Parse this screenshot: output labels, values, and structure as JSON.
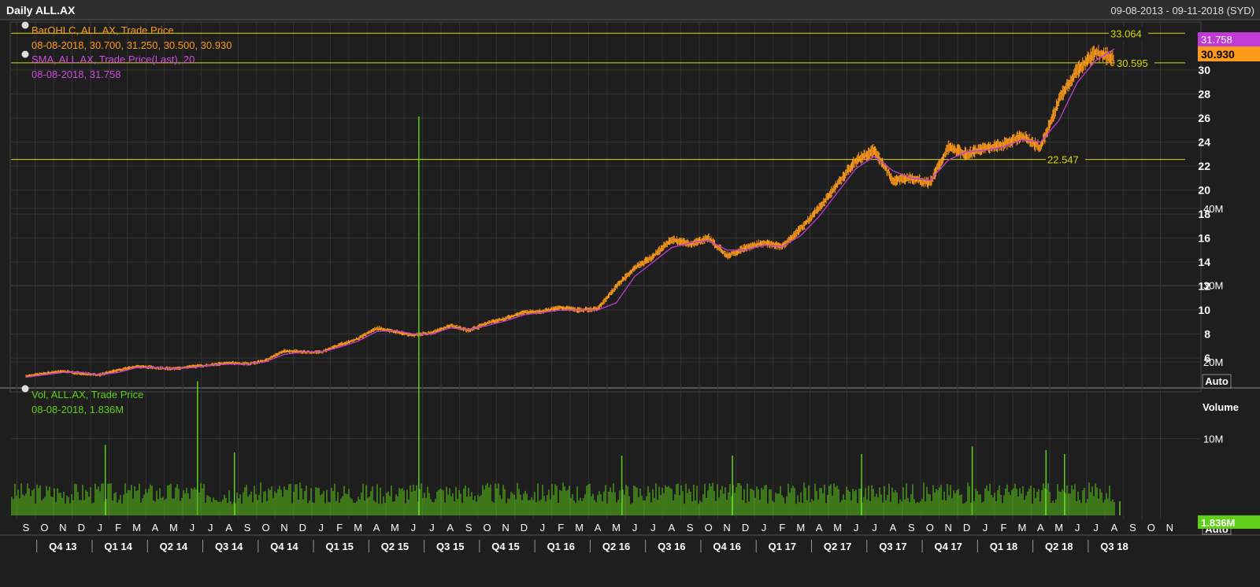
{
  "header": {
    "title": "Daily ALL.AX",
    "date_range": "09-08-2013 - 09-11-2018 (SYD)"
  },
  "colors": {
    "background": "#1e1e1e",
    "grid": "#333333",
    "price_bars": "#ff9a1a",
    "sma": "#c13bd6",
    "volume": "#5fcf1a",
    "hlines": "#d7d700",
    "axis_text": "#ffffff"
  },
  "legend": {
    "price_series": "BarOHLC, ALL.AX, Trade Price",
    "price_values": "08-08-2018, 30.700, 31.250, 30.500, 30.930",
    "sma_series": "SMA, ALL.AX, Trade Price(Last), 20",
    "sma_values": "08-08-2018, 31.758",
    "volume_series": "Vol, ALL.AX, Trade Price",
    "volume_values": "08-08-2018, 1.836M"
  },
  "price_axis": {
    "ticks": [
      "6",
      "8",
      "10",
      "12",
      "14",
      "16",
      "18",
      "20",
      "22",
      "24",
      "26",
      "28",
      "30"
    ],
    "scale_button": "Auto",
    "sma_tag": "31.758",
    "last_tag": "30.930"
  },
  "volume_axis": {
    "title": "Volume",
    "ticks": [
      "10M",
      "20M",
      "30M",
      "40M"
    ],
    "last_tag": "1.836M",
    "scale_button": "Auto"
  },
  "hlines": [
    "33.064",
    "30.595",
    "22.547"
  ],
  "time_axis": {
    "months": [
      "S",
      "O",
      "N",
      "D",
      "J",
      "F",
      "M",
      "A",
      "M",
      "J",
      "J",
      "A",
      "S",
      "O",
      "N",
      "D",
      "J",
      "F",
      "M",
      "A",
      "M",
      "J",
      "J",
      "A",
      "S",
      "O",
      "N",
      "D",
      "J",
      "F",
      "M",
      "A",
      "M",
      "J",
      "J",
      "A",
      "S",
      "O",
      "N",
      "D",
      "J",
      "F",
      "M",
      "A",
      "M",
      "J",
      "J",
      "A",
      "S",
      "O",
      "N",
      "D",
      "J",
      "F",
      "M",
      "A",
      "M",
      "J",
      "J",
      "A",
      "S",
      "O",
      "N"
    ],
    "quarters": [
      "Q4 13",
      "Q1 14",
      "Q2 14",
      "Q3 14",
      "Q4 14",
      "Q1 15",
      "Q2 15",
      "Q3 15",
      "Q4 15",
      "Q1 16",
      "Q2 16",
      "Q3 16",
      "Q4 16",
      "Q1 17",
      "Q2 17",
      "Q3 17",
      "Q4 17",
      "Q1 18",
      "Q2 18",
      "Q3 18"
    ]
  },
  "chart_data": [
    {
      "type": "line",
      "series": [
        {
          "name": "BarOHLC, ALL.AX, Trade Price",
          "x": [
            "2013-09",
            "2013-10",
            "2013-11",
            "2013-12",
            "2014-01",
            "2014-02",
            "2014-03",
            "2014-04",
            "2014-05",
            "2014-06",
            "2014-07",
            "2014-08",
            "2014-09",
            "2014-10",
            "2014-11",
            "2014-12",
            "2015-01",
            "2015-02",
            "2015-03",
            "2015-04",
            "2015-05",
            "2015-06",
            "2015-07",
            "2015-08",
            "2015-09",
            "2015-10",
            "2015-11",
            "2015-12",
            "2016-01",
            "2016-02",
            "2016-03",
            "2016-04",
            "2016-05",
            "2016-06",
            "2016-07",
            "2016-08",
            "2016-09",
            "2016-10",
            "2016-11",
            "2016-12",
            "2017-01",
            "2017-02",
            "2017-03",
            "2017-04",
            "2017-05",
            "2017-06",
            "2017-07",
            "2017-08",
            "2017-09",
            "2017-10",
            "2017-11",
            "2017-12",
            "2018-01",
            "2018-02",
            "2018-03",
            "2018-04",
            "2018-05",
            "2018-06",
            "2018-07",
            "2018-08"
          ],
          "values": [
            4.5,
            4.7,
            4.9,
            4.7,
            4.6,
            5.0,
            5.3,
            5.2,
            5.1,
            5.3,
            5.4,
            5.6,
            5.5,
            5.8,
            6.6,
            6.5,
            6.5,
            7.1,
            7.6,
            8.5,
            8.2,
            7.9,
            8.1,
            8.7,
            8.3,
            8.9,
            9.3,
            9.8,
            9.9,
            10.2,
            10.0,
            10.1,
            12.0,
            13.5,
            14.5,
            15.9,
            15.5,
            16.0,
            14.5,
            15.2,
            15.6,
            15.3,
            16.8,
            18.5,
            20.5,
            22.5,
            23.3,
            20.8,
            21.0,
            20.6,
            23.5,
            23.0,
            23.5,
            23.8,
            24.5,
            23.5,
            27.5,
            30.0,
            31.5,
            30.93
          ]
        },
        {
          "name": "SMA, ALL.AX, Trade Price(Last), 20",
          "x": [
            "2013-09",
            "2013-10",
            "2013-11",
            "2013-12",
            "2014-01",
            "2014-02",
            "2014-03",
            "2014-04",
            "2014-05",
            "2014-06",
            "2014-07",
            "2014-08",
            "2014-09",
            "2014-10",
            "2014-11",
            "2014-12",
            "2015-01",
            "2015-02",
            "2015-03",
            "2015-04",
            "2015-05",
            "2015-06",
            "2015-07",
            "2015-08",
            "2015-09",
            "2015-10",
            "2015-11",
            "2015-12",
            "2016-01",
            "2016-02",
            "2016-03",
            "2016-04",
            "2016-05",
            "2016-06",
            "2016-07",
            "2016-08",
            "2016-09",
            "2016-10",
            "2016-11",
            "2016-12",
            "2017-01",
            "2017-02",
            "2017-03",
            "2017-04",
            "2017-05",
            "2017-06",
            "2017-07",
            "2017-08",
            "2017-09",
            "2017-10",
            "2017-11",
            "2017-12",
            "2018-01",
            "2018-02",
            "2018-03",
            "2018-04",
            "2018-05",
            "2018-06",
            "2018-07",
            "2018-08"
          ],
          "values": [
            4.4,
            4.6,
            4.8,
            4.8,
            4.6,
            4.8,
            5.2,
            5.2,
            5.1,
            5.2,
            5.4,
            5.5,
            5.5,
            5.7,
            6.3,
            6.5,
            6.5,
            6.9,
            7.4,
            8.2,
            8.3,
            8.0,
            8.0,
            8.5,
            8.4,
            8.7,
            9.1,
            9.6,
            9.8,
            10.0,
            10.0,
            10.0,
            10.6,
            12.8,
            14.0,
            15.2,
            15.6,
            15.8,
            15.0,
            15.0,
            15.4,
            15.3,
            16.2,
            17.8,
            19.8,
            21.8,
            22.8,
            21.6,
            21.0,
            20.8,
            22.5,
            23.2,
            23.3,
            23.6,
            24.2,
            24.0,
            25.8,
            29.0,
            30.8,
            31.758
          ]
        }
      ],
      "ylim": [
        4,
        33.5
      ],
      "grid": true,
      "legend_position": "top-left"
    },
    {
      "type": "bar",
      "series": [
        {
          "name": "Vol, ALL.AX, Trade Price",
          "x": [
            "2014-01",
            "2014-06",
            "2014-08",
            "2015-06",
            "2016-05",
            "2016-11",
            "2017-06",
            "2017-12",
            "2018-04",
            "2018-05",
            "2018-08"
          ],
          "values_millions": [
            9.2,
            17.5,
            8.2,
            52.0,
            7.8,
            7.8,
            8.0,
            9.0,
            8.5,
            8.0,
            1.836
          ]
        }
      ],
      "ylim_millions": [
        0,
        50
      ],
      "grid": true
    }
  ]
}
